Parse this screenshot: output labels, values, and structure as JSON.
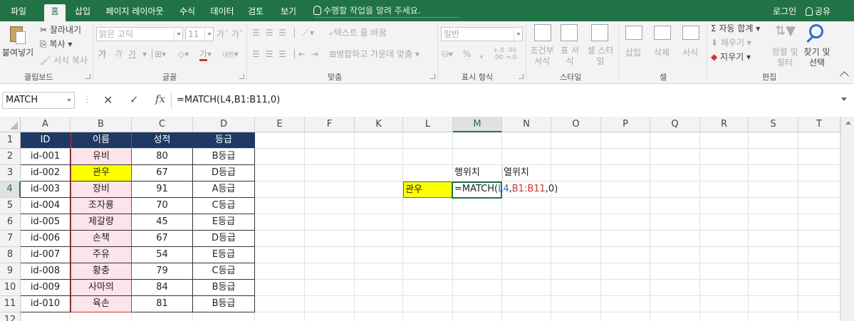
{
  "tabs": [
    "파일",
    "홈",
    "삽입",
    "페이지 레이아웃",
    "수식",
    "데이터",
    "검토",
    "보기"
  ],
  "tell_me": "수행할 작업을 알려 주세요.",
  "login": "로그인",
  "share": "공유",
  "colors": {
    "brand": "#217346",
    "header_fill": "#203864",
    "highlight": "#ffff00",
    "pink_fill": "#fce4ea",
    "ref_blue": "#2e6fd0",
    "ref_red": "#d23131"
  },
  "ribbon": {
    "clipboard": {
      "paste": "붙여넣기",
      "cut": "잘라내기",
      "copy": "복사",
      "format_painter": "서식 복사",
      "label": "클립보드"
    },
    "font": {
      "name": "맑은 고딕",
      "size": "11",
      "bold": "가",
      "italic": "가",
      "underline": "가",
      "phonetic": "내천",
      "label": "글꼴"
    },
    "alignment": {
      "wrap": "텍스트 줄 바꿈",
      "merge": "병합하고 가운데 맞춤",
      "label": "맞춤"
    },
    "number": {
      "format": "일반",
      "percent": "%",
      "comma": ",",
      "label": "표시 형식"
    },
    "styles": {
      "conditional": "조건부 서식",
      "table": "표 서식",
      "cell": "셀 스타일",
      "label": "스타일"
    },
    "cells": {
      "insert": "삽입",
      "delete": "삭제",
      "format": "서식",
      "label": "셀"
    },
    "editing": {
      "autosum": "자동 합계",
      "fill": "채우기",
      "clear": "지우기",
      "sort": "정렬 및 필터",
      "find": "찾기 및 선택",
      "label": "편집"
    }
  },
  "formula_bar": {
    "name_box": "MATCH",
    "cancel": "✕",
    "enter": "✓",
    "fx": "fx",
    "formula": "=MATCH(L4,B1:B11,0)"
  },
  "columns": [
    "A",
    "B",
    "C",
    "D",
    "E",
    "F",
    "K",
    "L",
    "M",
    "N",
    "O",
    "P",
    "Q",
    "R",
    "S",
    "T"
  ],
  "rows": [
    "1",
    "2",
    "3",
    "4",
    "5",
    "6",
    "7",
    "8",
    "9",
    "10",
    "11",
    "12"
  ],
  "table": {
    "headers": [
      "ID",
      "이름",
      "성적",
      "등급"
    ],
    "rows": [
      [
        "id-001",
        "유비",
        "80",
        "B등급"
      ],
      [
        "id-002",
        "관우",
        "67",
        "D등급"
      ],
      [
        "id-003",
        "장비",
        "91",
        "A등급"
      ],
      [
        "id-004",
        "조자룡",
        "70",
        "C등급"
      ],
      [
        "id-005",
        "제갈량",
        "45",
        "E등급"
      ],
      [
        "id-006",
        "손책",
        "67",
        "D등급"
      ],
      [
        "id-007",
        "주유",
        "54",
        "E등급"
      ],
      [
        "id-008",
        "황충",
        "79",
        "C등급"
      ],
      [
        "id-009",
        "사마의",
        "84",
        "B등급"
      ],
      [
        "id-010",
        "육손",
        "81",
        "B등급"
      ]
    ]
  },
  "side": {
    "m3": "행위치",
    "n3": "열위치",
    "l4": "관우",
    "edit": {
      "prefix": "=MATCH(",
      "ref1": "L4",
      "c1": ",",
      "ref2": "B1:B11",
      "suffix": ",0)"
    }
  }
}
